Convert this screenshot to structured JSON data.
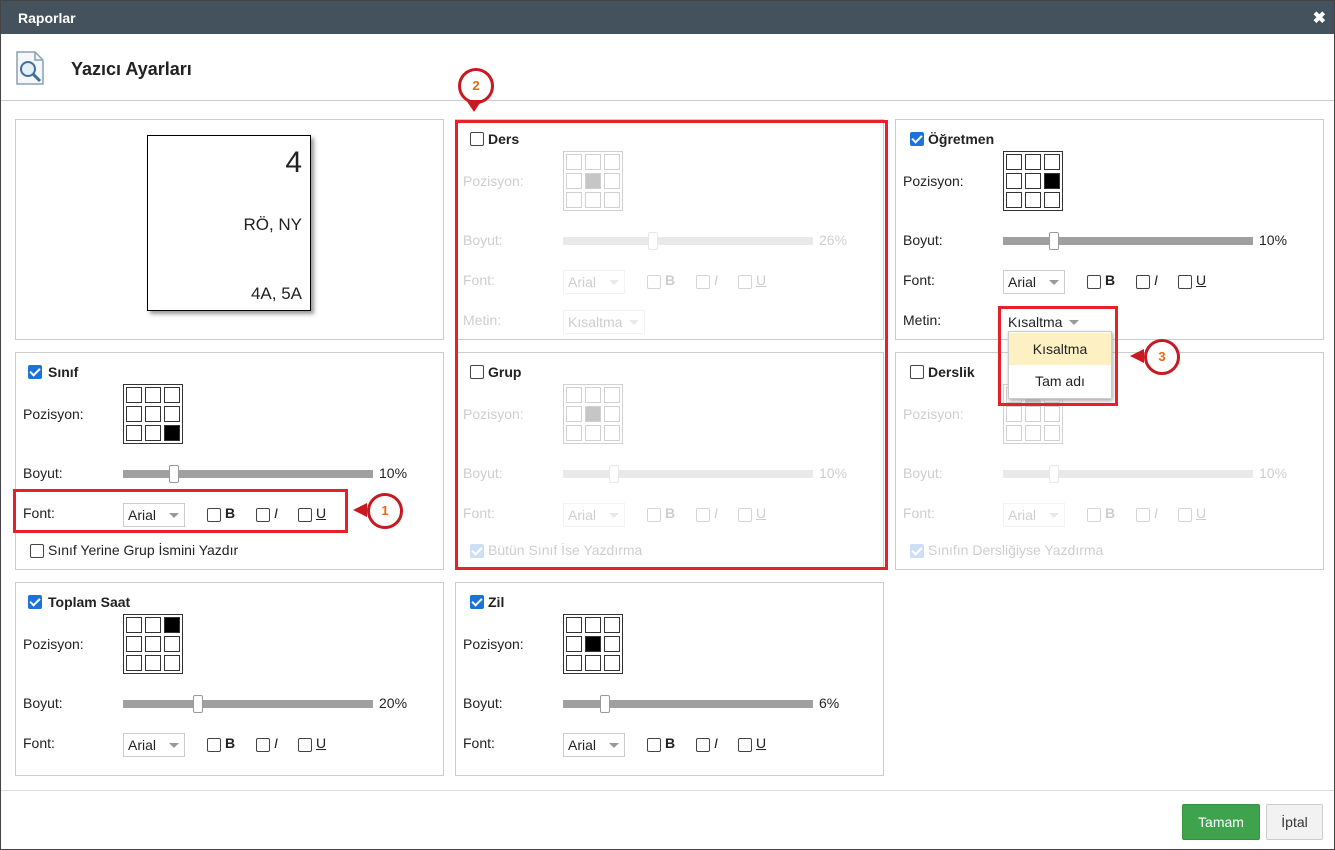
{
  "window": {
    "title": "Raporlar",
    "close": "✖"
  },
  "header": {
    "title": "Yazıcı Ayarları",
    "icon": "printer-search-icon"
  },
  "preview": {
    "top": "4",
    "middle": "RÖ, NY",
    "bottom": "4A, 5A"
  },
  "labels": {
    "position": "Pozisyon:",
    "size": "Boyut:",
    "font": "Font:",
    "text": "Metin:",
    "bold": "B",
    "italic": "I",
    "underline": "U"
  },
  "panels": {
    "ders": {
      "title": "Ders",
      "checked": false,
      "size_pct": 26,
      "size_text": "26%",
      "font": "Arial",
      "text_mode": "Kısaltma",
      "selected_cell": 4
    },
    "ogretmen": {
      "title": "Öğretmen",
      "checked": true,
      "size_pct": 10,
      "size_text": "10%",
      "font": "Arial",
      "text_mode": "Kısaltma",
      "selected_cell": 5
    },
    "sinif": {
      "title": "Sınıf",
      "checked": true,
      "size_pct": 10,
      "size_text": "10%",
      "font": "Arial",
      "selected_cell": 8,
      "option": "Sınıf Yerine Grup İsmini Yazdır",
      "option_checked": false
    },
    "grup": {
      "title": "Grup",
      "checked": false,
      "size_pct": 10,
      "size_text": "10%",
      "font": "Arial",
      "selected_cell": 4,
      "option": "Bütün Sınıf İse Yazdırma",
      "option_checked": true
    },
    "derslik": {
      "title": "Derslik",
      "checked": false,
      "size_pct": 10,
      "size_text": "10%",
      "font": "Arial",
      "selected_cell": 1,
      "option": "Sınıfın Dersliğiyse Yazdırma",
      "option_checked": true
    },
    "toplam": {
      "title": "Toplam Saat",
      "checked": true,
      "size_pct": 20,
      "size_text": "20%",
      "font": "Arial",
      "selected_cell": 2
    },
    "zil": {
      "title": "Zil",
      "checked": true,
      "size_pct": 6,
      "size_text": "6%",
      "font": "Arial",
      "selected_cell": 4
    }
  },
  "dropdown": {
    "options": [
      "Kısaltma",
      "Tam adı"
    ],
    "highlighted": 0
  },
  "annotations": {
    "one": "1",
    "two": "2",
    "three": "3"
  },
  "buttons": {
    "ok": "Tamam",
    "cancel": "İptal"
  },
  "colors": {
    "titlebar": "#44525e",
    "ok": "#3fa34d",
    "annotation": "#e8202a",
    "checkbox": "#1a73d8"
  }
}
